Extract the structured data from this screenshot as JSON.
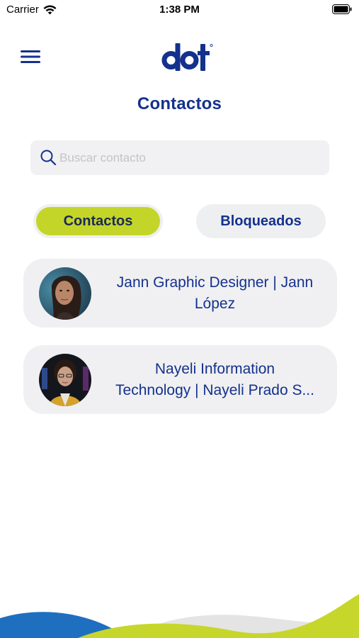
{
  "status_bar": {
    "carrier": "Carrier",
    "time": "1:38 PM"
  },
  "header": {
    "title": "Contactos",
    "logo_text": "dot"
  },
  "search": {
    "placeholder": "Buscar contacto",
    "value": ""
  },
  "tabs": [
    {
      "label": "Contactos",
      "active": true
    },
    {
      "label": "Bloqueados",
      "active": false
    }
  ],
  "contacts": [
    {
      "name": "Jann Graphic Designer | Jann López",
      "line1": "Jann Graphic Designer | Jann",
      "line2": "López"
    },
    {
      "name": "Nayeli Information Technology | Nayeli Prado S...",
      "line1": "Nayeli Information",
      "line2": "Technology | Nayeli Prado S..."
    }
  ],
  "colors": {
    "brand_blue": "#14318d",
    "accent_green": "#c4d52a",
    "wave_blue": "#1f6fc0",
    "wave_green": "#c7d62b",
    "card_bg": "#f0f0f2"
  },
  "icons": {
    "menu": "hamburger-icon",
    "search": "search-icon",
    "wifi": "wifi-icon",
    "battery": "battery-icon"
  }
}
